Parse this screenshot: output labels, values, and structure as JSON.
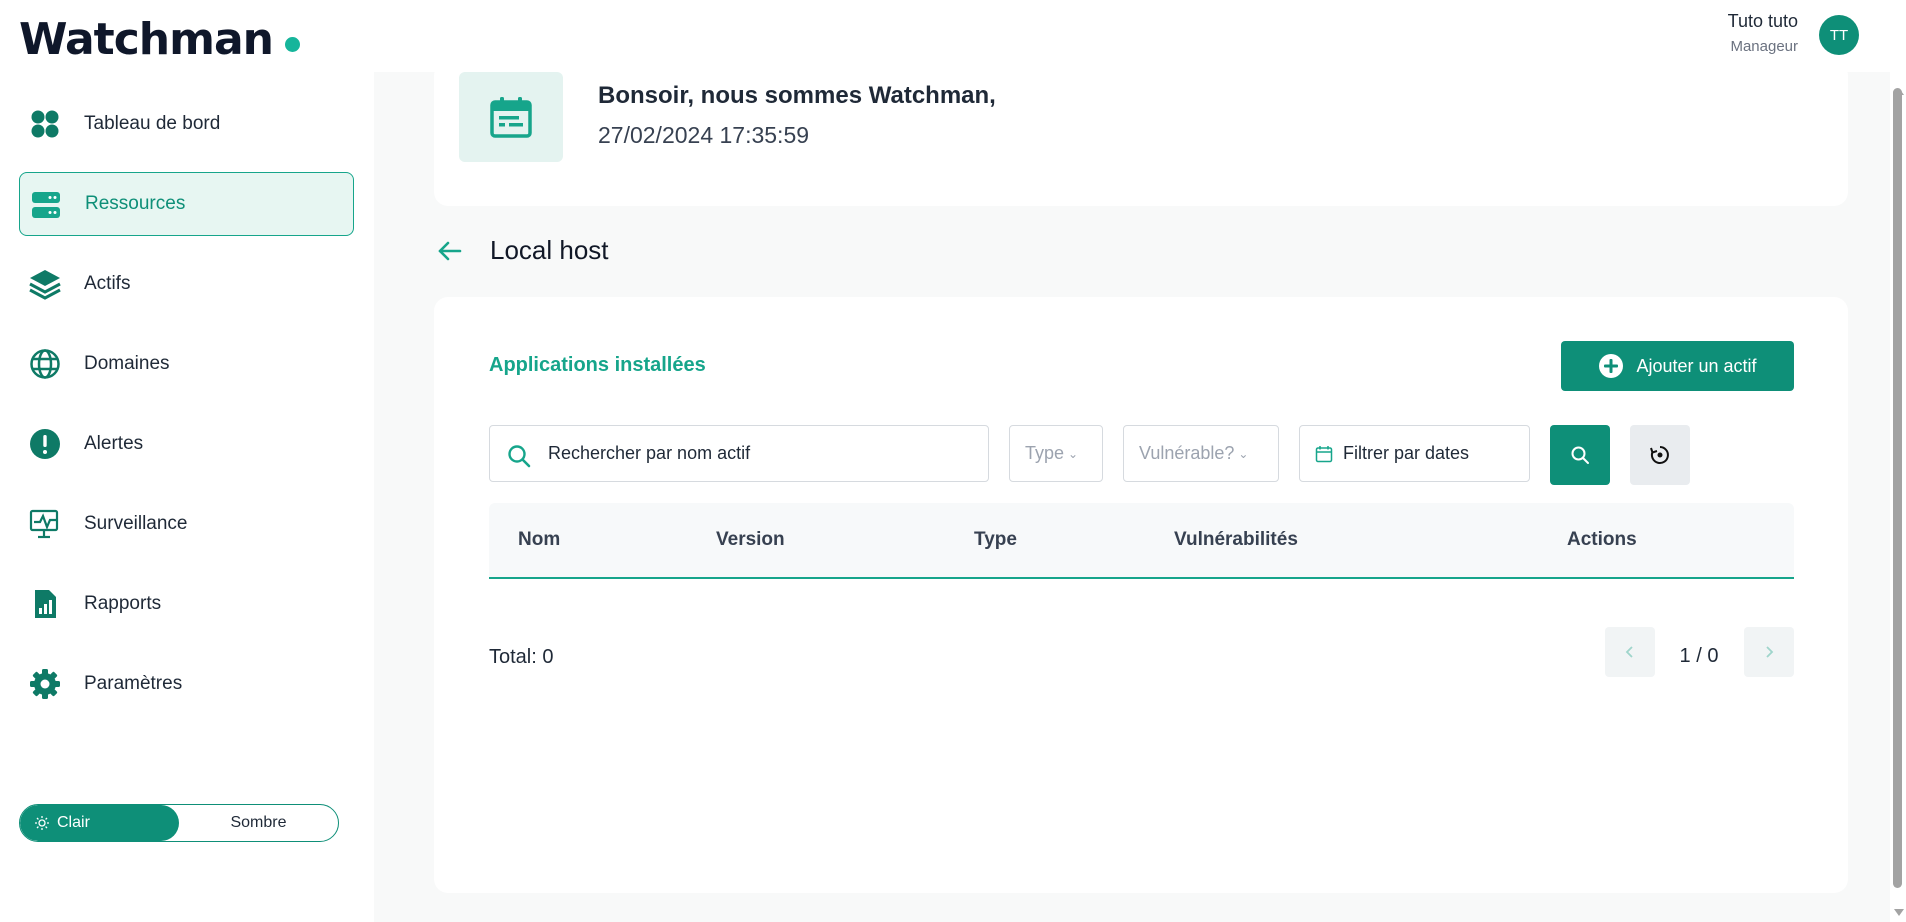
{
  "app": {
    "logo": "Watchman",
    "brand_color": "#0e8f78",
    "accent_color": "#16b59b"
  },
  "user": {
    "name": "Tuto tuto",
    "role": "Manageur",
    "initials": "TT"
  },
  "sidebar": {
    "items": [
      {
        "label": "Tableau de bord",
        "icon": "dashboard-icon"
      },
      {
        "label": "Ressources",
        "icon": "server-icon",
        "active": true
      },
      {
        "label": "Actifs",
        "icon": "layers-icon"
      },
      {
        "label": "Domaines",
        "icon": "globe-icon"
      },
      {
        "label": "Alertes",
        "icon": "alert-icon"
      },
      {
        "label": "Surveillance",
        "icon": "monitor-icon"
      },
      {
        "label": "Rapports",
        "icon": "report-icon"
      },
      {
        "label": "Paramètres",
        "icon": "gear-icon"
      }
    ],
    "theme": {
      "light_label": "Clair",
      "dark_label": "Sombre",
      "selected": "Clair"
    }
  },
  "welcome": {
    "greeting": "Bonsoir, nous sommes Watchman,",
    "datetime": "27/02/2024 17:35:59"
  },
  "page": {
    "title": "Local host"
  },
  "apps_section": {
    "title": "Applications installées",
    "add_button": "Ajouter un actif",
    "search_placeholder": "Rechercher par nom actif",
    "type_filter": "Type",
    "vuln_filter": "Vulnérable?",
    "date_filter": "Filtrer par dates",
    "columns": [
      "Nom",
      "Version",
      "Type",
      "Vulnérabilités",
      "Actions"
    ],
    "rows": [],
    "total": "Total: 0",
    "pagination": "1 / 0"
  }
}
